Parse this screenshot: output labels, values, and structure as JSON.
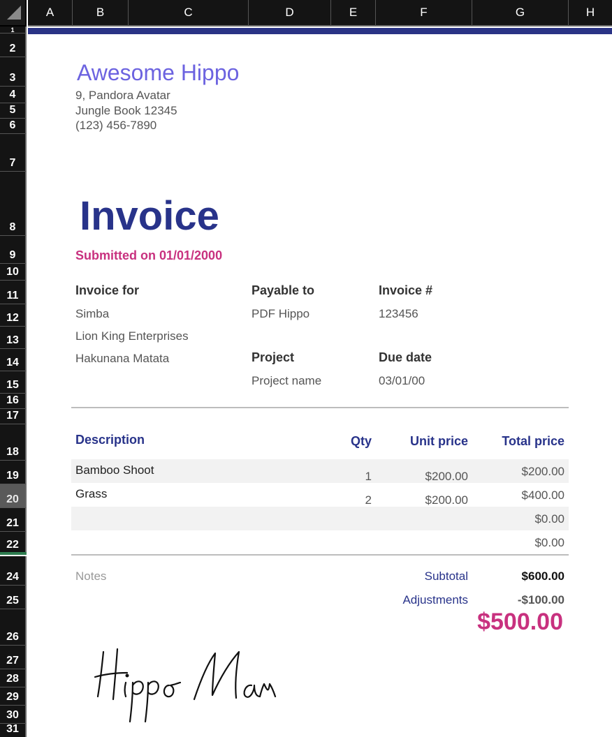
{
  "sheet": {
    "columns": [
      "A",
      "B",
      "C",
      "D",
      "E",
      "F",
      "G",
      "H"
    ],
    "rows": [
      "1",
      "2",
      "3",
      "4",
      "5",
      "6",
      "7",
      "8",
      "9",
      "10",
      "11",
      "12",
      "13",
      "14",
      "15",
      "16",
      "17",
      "18",
      "19",
      "20",
      "21",
      "22",
      "24",
      "25",
      "26",
      "27",
      "28",
      "29",
      "30",
      "31"
    ],
    "selected_row": "20"
  },
  "company": {
    "name": "Awesome Hippo",
    "address_line1": "9, Pandora Avatar",
    "address_line2": "Jungle Book 12345",
    "phone": "(123) 456-7890"
  },
  "invoice": {
    "title": "Invoice",
    "submitted": "Submitted on 01/01/2000",
    "for_label": "Invoice for",
    "for_name": "Simba",
    "for_company": "Lion King Enterprises",
    "for_address": "Hakunana Matata",
    "payable_label": "Payable to",
    "payable_value": "PDF Hippo",
    "number_label": "Invoice #",
    "number_value": "123456",
    "project_label": "Project",
    "project_value": "Project name",
    "due_label": "Due date",
    "due_value": "03/01/00"
  },
  "table": {
    "headers": {
      "description": "Description",
      "qty": "Qty",
      "unit_price": "Unit price",
      "total_price": "Total price"
    },
    "rows": [
      {
        "description": "Bamboo Shoot",
        "qty": "1",
        "unit_price": "$200.00",
        "total": "$200.00"
      },
      {
        "description": "Grass",
        "qty": "2",
        "unit_price": "$200.00",
        "total": "$400.00"
      },
      {
        "description": "",
        "qty": "",
        "unit_price": "",
        "total": "$0.00"
      },
      {
        "description": "",
        "qty": "",
        "unit_price": "",
        "total": "$0.00"
      }
    ]
  },
  "summary": {
    "notes_label": "Notes",
    "subtotal_label": "Subtotal",
    "subtotal_value": "$600.00",
    "adjustments_label": "Adjustments",
    "adjustments_value": "-$100.00",
    "grand_total": "$500.00"
  },
  "signature": {
    "text": "Hippo Man"
  },
  "colors": {
    "accent": "#28338a",
    "brand": "#6c63e0",
    "highlight": "#c8317f",
    "chrome": "#141414"
  }
}
